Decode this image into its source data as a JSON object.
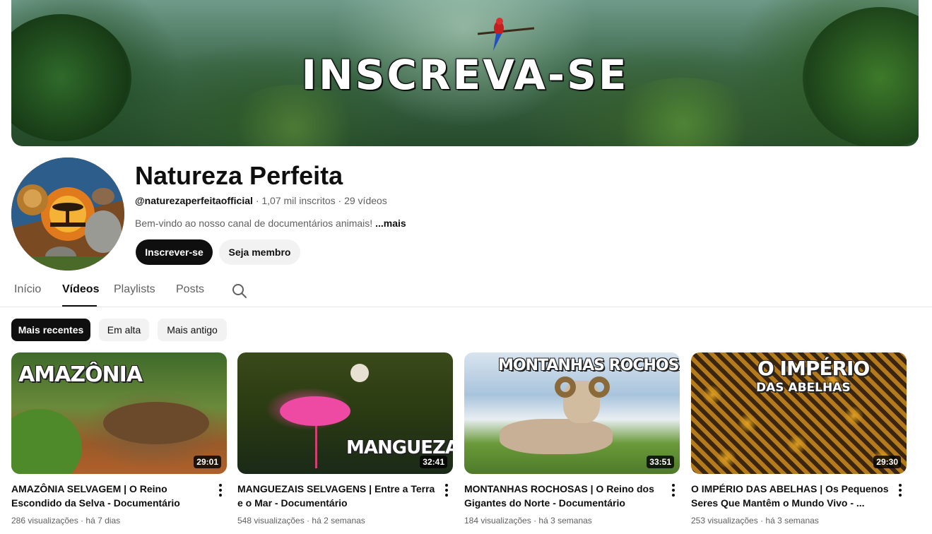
{
  "banner": {
    "title": "INSCREVA-SE"
  },
  "channel": {
    "name": "Natureza Perfeita",
    "handle": "@naturezaperfeitaofficial",
    "subscribers": "1,07 mil inscritos",
    "videos_count": "29 vídeos",
    "separator": "·",
    "description": "Bem-vindo ao nosso canal de documentários animais!",
    "more_label": "...mais"
  },
  "buttons": {
    "subscribe": "Inscrever-se",
    "member": "Seja membro"
  },
  "tabs": [
    {
      "label": "Início"
    },
    {
      "label": "Vídeos"
    },
    {
      "label": "Playlists"
    },
    {
      "label": "Posts"
    }
  ],
  "active_tab": "Vídeos",
  "chips": [
    {
      "label": "Mais recentes"
    },
    {
      "label": "Em alta"
    },
    {
      "label": "Mais antigo"
    }
  ],
  "active_chip": "Mais recentes",
  "videos": [
    {
      "thumb_text": "AMAZÔNIA",
      "duration": "29:01",
      "title": "AMAZÔNIA SELVAGEM | O Reino Escondido da Selva - Documentário",
      "views": "286 visualizações",
      "age": "há 7 dias"
    },
    {
      "thumb_text": "MANGUEZAIS",
      "duration": "32:41",
      "title": "MANGUEZAIS SELVAGENS | Entre a Terra e o Mar - Documentário",
      "views": "548 visualizações",
      "age": "há 2 semanas"
    },
    {
      "thumb_text": "MONTANHAS ROCHOSAS",
      "duration": "33:51",
      "title": "MONTANHAS ROCHOSAS | O Reino dos Gigantes do Norte - Documentário",
      "views": "184 visualizações",
      "age": "há 3 semanas"
    },
    {
      "thumb_text": "O IMPÉRIO",
      "thumb_subtext": "DAS ABELHAS",
      "duration": "29:30",
      "title": "O IMPÉRIO DAS ABELHAS | Os Pequenos Seres Que Mantêm o Mundo Vivo - ...",
      "views": "253 visualizações",
      "age": "há 3 semanas"
    }
  ],
  "colors": {
    "text": "#0f0f0f",
    "secondary": "#606060",
    "chip_bg": "#f2f2f2",
    "subscribe_bg": "#0f0f0f"
  },
  "icons": [
    "search-icon",
    "more-vert-icon"
  ]
}
